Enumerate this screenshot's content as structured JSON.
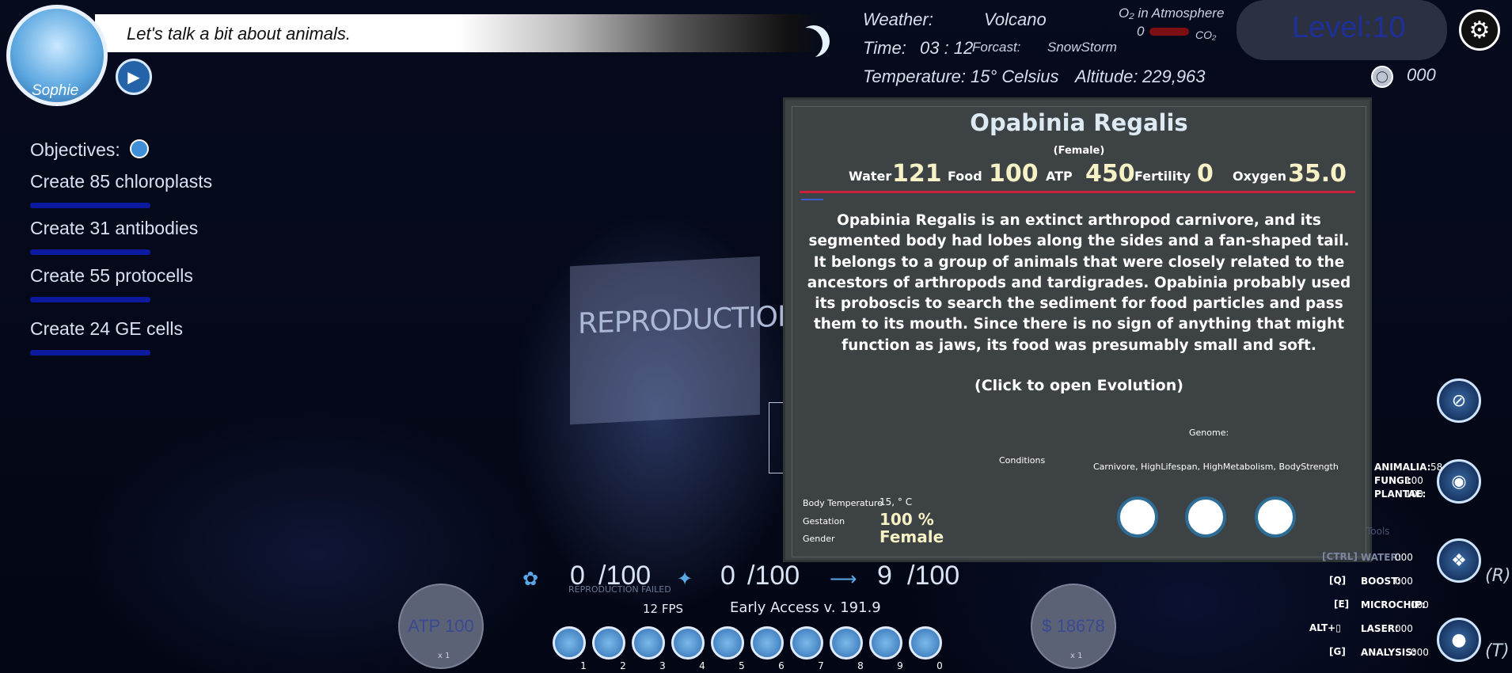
{
  "dialogue": {
    "character_name": "Sophie",
    "text": "Let's talk a bit about animals."
  },
  "environment": {
    "weather_label": "Weather:",
    "weather_value": "Volcano",
    "time_label": "Time:",
    "time_value": "03 : 12",
    "forecast_label": "Forcast:",
    "forecast_value": "SnowStorm",
    "temperature_label": "Temperature:",
    "temperature_value": "15° Celsius",
    "altitude_label": "Altitude:",
    "altitude_value": "229,963",
    "o2_label": "O₂ in Atmosphere",
    "o2_value": "0",
    "co2_label": "CO₂"
  },
  "level": {
    "label": "Level:10"
  },
  "shield_count": "000",
  "objectives": {
    "title": "Objectives:",
    "items": [
      "Create 85 chloroplasts",
      "Create 31 antibodies",
      "Create 55 protocells",
      "Create 24 GE cells"
    ]
  },
  "scene": {
    "sign_text": "REPRODUCTION"
  },
  "species_panel": {
    "name": "Opabinia Regalis",
    "sex": "(Female)",
    "stats": [
      {
        "label": "Water",
        "value": "121"
      },
      {
        "label": "Food",
        "value": "100"
      },
      {
        "label": "ATP",
        "value": "450"
      },
      {
        "label": "Fertility",
        "value": "0"
      },
      {
        "label": "Oxygen",
        "value": "35.0"
      }
    ],
    "description": "Opabinia Regalis is an extinct arthropod carnivore, and its segmented body had lobes along the sides and a fan-shaped tail. It belongs to a group of animals that were closely related to the ancestors of arthropods and tardigrades. Opabinia probably used its proboscis to search the sediment for food particles and pass them to its mouth. Since there is no sign of anything that might function as jaws, its food was presumably small and soft.",
    "click_hint": "(Click to open Evolution)",
    "genome_label": "Genome:",
    "genome_value": "Carnivore, HighLifespan, HighMetabolism, BodyStrength",
    "conditions_label": "Conditions",
    "body_temp_label": "Body Temperature",
    "body_temp_value": "15, ° C",
    "gestation_label": "Gestation",
    "gestation_value": "100 %",
    "gender_label": "Gender",
    "gender_value": "Female"
  },
  "resources": [
    {
      "icon": "leaf-icon",
      "current": "0",
      "max": "/100"
    },
    {
      "icon": "fish-icon",
      "current": "0",
      "max": "/100"
    },
    {
      "icon": "dinosaur-icon",
      "current": "9",
      "max": "/100"
    }
  ],
  "status": {
    "reproduction_failed": "REPRODUCTION FAILED",
    "fps": "12 FPS",
    "version": "Early Access  v. 191.9"
  },
  "atp_gauge": {
    "label": "ATP  100",
    "multiplier": "x 1"
  },
  "money_gauge": {
    "label": "$  18678",
    "multiplier": "x 1"
  },
  "hotbar": [
    "1",
    "2",
    "3",
    "4",
    "5",
    "6",
    "7",
    "8",
    "9",
    "0"
  ],
  "kingdoms": [
    {
      "label": "ANIMALIA:",
      "value": "58"
    },
    {
      "label": "FUNGI:",
      "value": "100"
    },
    {
      "label": "PLANTAE:",
      "value": "100"
    }
  ],
  "tools": {
    "title": "Tools",
    "items": [
      {
        "key": "[CTRL]",
        "label": "WATER:",
        "value": "000"
      },
      {
        "key": "[Q]",
        "label": "BOOST:",
        "value": "000"
      },
      {
        "key": "[E]",
        "label": "MICROCHIP:",
        "value": "000"
      },
      {
        "key": "ALT+▯",
        "label": "LASER:",
        "value": "000"
      },
      {
        "key": "[G]",
        "label": "ANALYSIS:",
        "value": "000"
      }
    ]
  },
  "key_hints": {
    "dna": "(R)",
    "network": "(T)"
  },
  "colors": {
    "panel_bg": "#3d4244",
    "stat_value": "#f7f1c6",
    "level_text": "#1e2f9a",
    "objective_bar": "#0c1aa0"
  }
}
